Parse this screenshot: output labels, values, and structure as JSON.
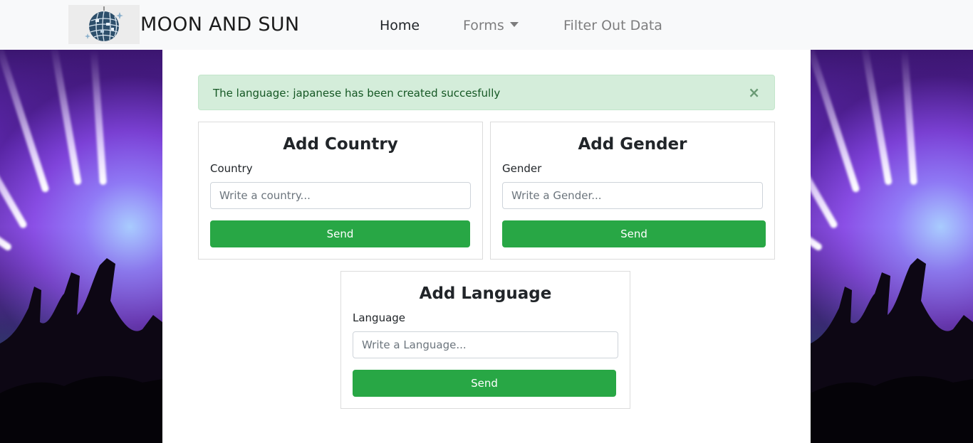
{
  "brand": {
    "name": "MOON AND SUN",
    "logo_icon": "disco-ball-icon"
  },
  "nav": {
    "home": "Home",
    "forms": "Forms",
    "filter": "Filter Out Data"
  },
  "alert": {
    "message": "The language: japanese has been created succesfully",
    "close_symbol": "×"
  },
  "forms": {
    "country": {
      "title": "Add Country",
      "label": "Country",
      "placeholder": "Write a country...",
      "button": "Send"
    },
    "gender": {
      "title": "Add Gender",
      "label": "Gender",
      "placeholder": "Write a Gender...",
      "button": "Send"
    },
    "language": {
      "title": "Add Language",
      "label": "Language",
      "placeholder": "Write a Language...",
      "button": "Send"
    }
  },
  "colors": {
    "success": "#28a745",
    "alert_bg": "#d4edda",
    "alert_text": "#155724",
    "navbar_bg": "#f8f9fa"
  }
}
